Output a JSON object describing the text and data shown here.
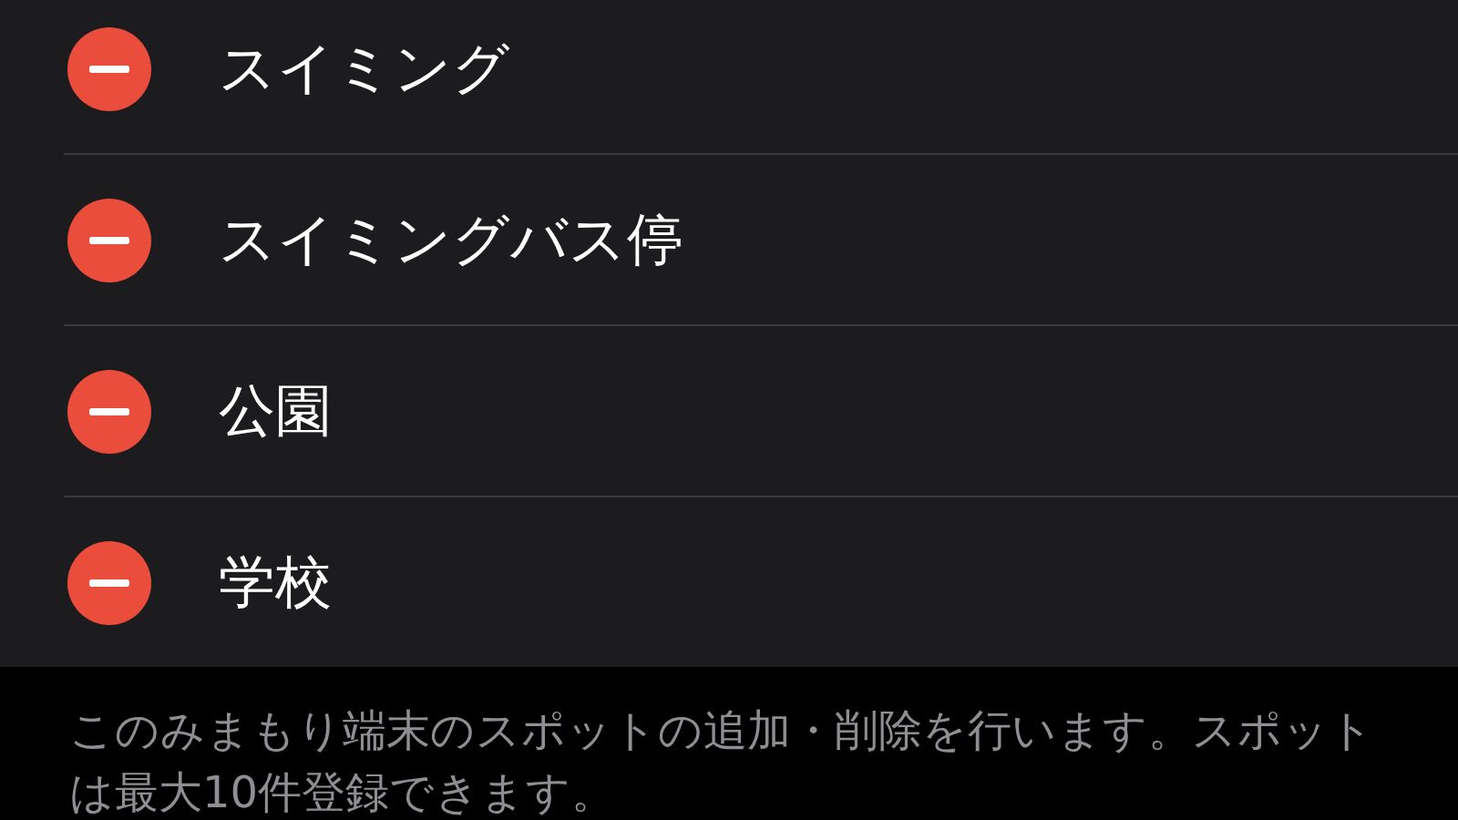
{
  "spots": [
    {
      "name": "スイミング"
    },
    {
      "name": "スイミングバス停"
    },
    {
      "name": "公園"
    },
    {
      "name": "学校"
    }
  ],
  "footer_note": "このみまもり端末のスポットの追加・削除を行います。スポットは最大10件登録できます。"
}
